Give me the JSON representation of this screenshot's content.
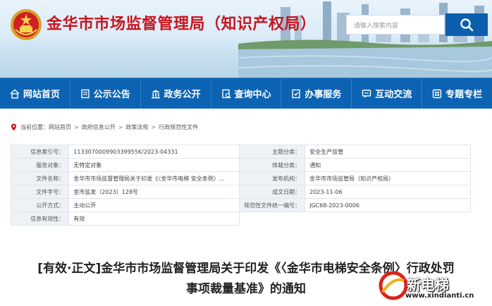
{
  "header": {
    "site_title": "金华市市场监督管理局（知识产权局）",
    "search_placeholder": "请输入搜索内容"
  },
  "nav": [
    {
      "label": "网站首页",
      "icon": "home-icon"
    },
    {
      "label": "公示公告",
      "icon": "notice-icon"
    },
    {
      "label": "政务公开",
      "icon": "government-icon"
    },
    {
      "label": "查询中心",
      "icon": "query-icon"
    },
    {
      "label": "办事服务",
      "icon": "service-icon"
    },
    {
      "label": "互动交流",
      "icon": "interaction-icon"
    },
    {
      "label": "专题专栏",
      "icon": "topic-icon"
    }
  ],
  "breadcrumb": {
    "prefix": "当前位置：",
    "items": [
      "网站首页",
      "政府信息公开",
      "政策法规",
      "行政规范性文件"
    ]
  },
  "info": {
    "index_label": "信息索引号：",
    "index_value": "113307000990339955K/2023-04331",
    "topic_label": "主题分类：",
    "topic_value": "安全生产监管",
    "service_label": "服务对象：",
    "service_value": "无特定对象",
    "genre_label": "体裁分类：",
    "genre_value": "通知",
    "doc_name_label": "文件名称：",
    "doc_name_value": "金华市市场监督管理局关于印发《〈金华市电梯 安全条例〉...",
    "issuer_label": "发布机构：",
    "issuer_value": "金华市市场监管局（知识产权局）",
    "doc_no_label": "文件字号：",
    "doc_no_value": "金市监发〔2023〕128号",
    "date_label": "成文日期：",
    "date_value": "2023-11-06",
    "public_label": "公开方式：",
    "public_value": "主动公开",
    "code_label": "规范性文件统一编号：",
    "code_value": "JGC68-2023-0006",
    "validity_label": "信息有效性：",
    "validity_value": "有效"
  },
  "article": {
    "title_line1": "[有效·正文]金华市市场监督管理局关于印发《〈金华市电梯安全条例〉行政处罚",
    "title_line2": "事项裁量基准》的通知"
  },
  "watermark": {
    "text": "新电梯",
    "url": "www.xindianti.cn"
  },
  "colors": {
    "brand_red": "#c8141e",
    "nav_blue": "#0d63b3",
    "search_blue": "#0b5fad"
  }
}
